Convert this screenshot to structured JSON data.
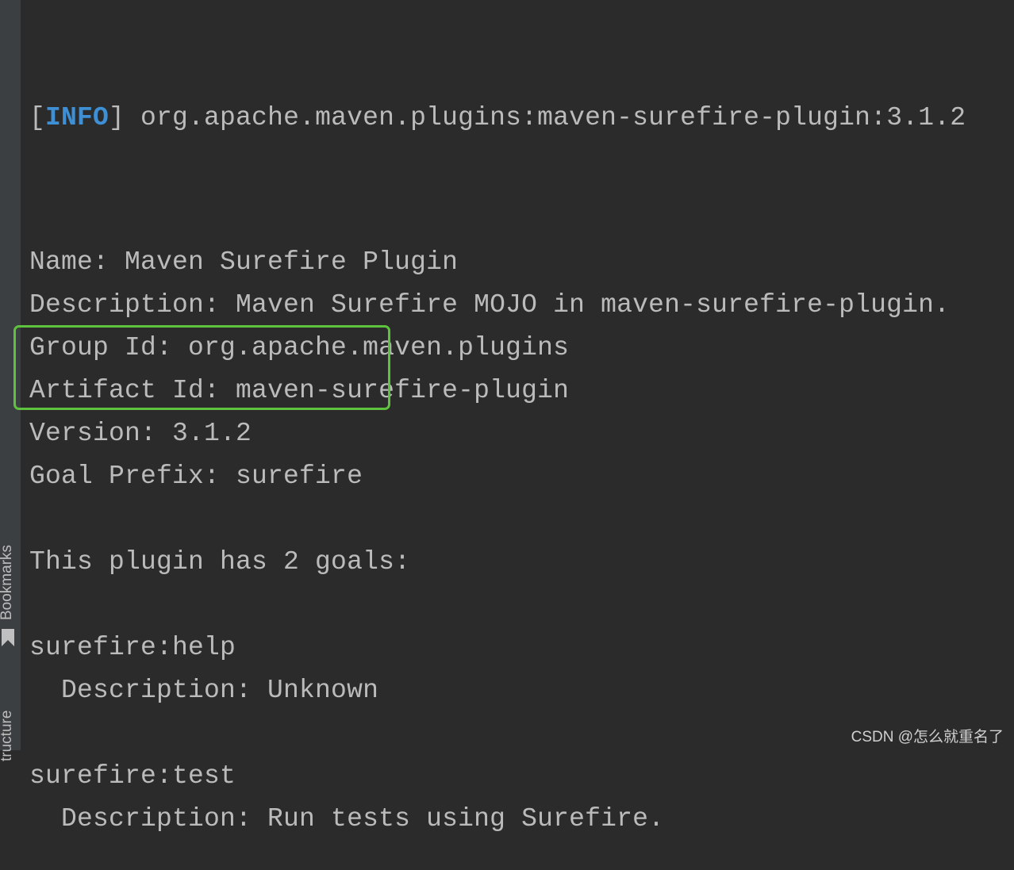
{
  "sidebar": {
    "bookmarks_label": "Bookmarks",
    "structure_label": "tructure"
  },
  "console": {
    "info_open": "[",
    "info_tag": "INFO",
    "info_rest": "] org.apache.maven.plugins:maven-surefire-plugin:3.1.2",
    "lines": [
      "",
      "Name: Maven Surefire Plugin",
      "Description: Maven Surefire MOJO in maven-surefire-plugin.",
      "Group Id: org.apache.maven.plugins",
      "Artifact Id: maven-surefire-plugin",
      "Version: 3.1.2",
      "Goal Prefix: surefire",
      "",
      "This plugin has 2 goals:",
      "",
      "surefire:help",
      "  Description: Unknown",
      "",
      "surefire:test",
      "  Description: Run tests using Surefire."
    ]
  },
  "highlight_color": "#5ec23e",
  "info_color": "#3f8fd4",
  "watermark": "CSDN @怎么就重名了"
}
